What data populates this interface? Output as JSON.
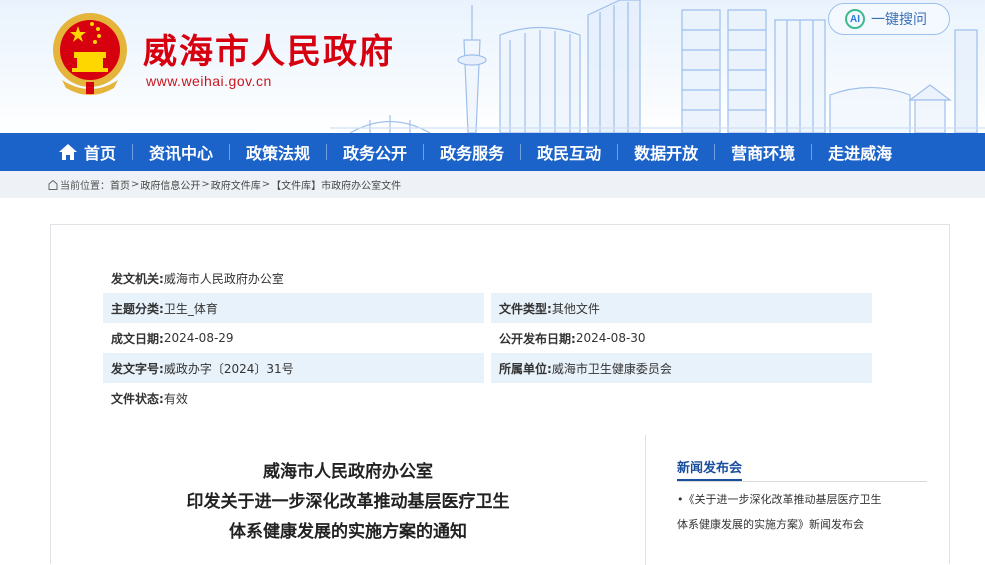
{
  "header": {
    "title": "威海市人民政府",
    "url": "www.weihai.gov.cn",
    "search": {
      "ai_label": "AI",
      "label": "一键搜问"
    }
  },
  "nav": {
    "items": [
      {
        "label": "首页",
        "icon": "home-icon"
      },
      {
        "label": "资讯中心"
      },
      {
        "label": "政策法规"
      },
      {
        "label": "政务公开"
      },
      {
        "label": "政务服务"
      },
      {
        "label": "政民互动"
      },
      {
        "label": "数据开放"
      },
      {
        "label": "营商环境"
      },
      {
        "label": "走进威海"
      }
    ]
  },
  "breadcrumb": {
    "prefix": "当前位置：",
    "items": [
      "首页",
      "政府信息公开",
      "政府文件库",
      "【文件库】市政府办公室文件"
    ],
    "separator": ">"
  },
  "meta": {
    "issuer_key": "发文机关:",
    "issuer": "威海市人民政府办公室",
    "topic_key": "主题分类:",
    "topic": "卫生_体育",
    "doctype_key": "文件类型:",
    "doctype": "其他文件",
    "date_key": "成文日期:",
    "date": "2024-08-29",
    "pubdate_key": "公开发布日期:",
    "pubdate": "2024-08-30",
    "docno_key": "发文字号:",
    "docno": "威政办字〔2024〕31号",
    "unit_key": "所属单位:",
    "unit": "威海市卫生健康委员会",
    "status_key": "文件状态:",
    "status": "有效"
  },
  "document": {
    "title_lines": [
      "威海市人民政府办公室",
      "印发关于进一步深化改革推动基层医疗卫生",
      "体系健康发展的实施方案的通知"
    ]
  },
  "sidebar": {
    "title": "新闻发布会",
    "link_line1": "•《关于进一步深化改革推动基层医疗卫生",
    "link_line2": "体系健康发展的实施方案》新闻发布会"
  },
  "colors": {
    "brand_red": "#d7000f",
    "nav_blue": "#1c63c9",
    "meta_shade": "#e8f2fb",
    "sidebar_blue": "#1a4f9e"
  }
}
